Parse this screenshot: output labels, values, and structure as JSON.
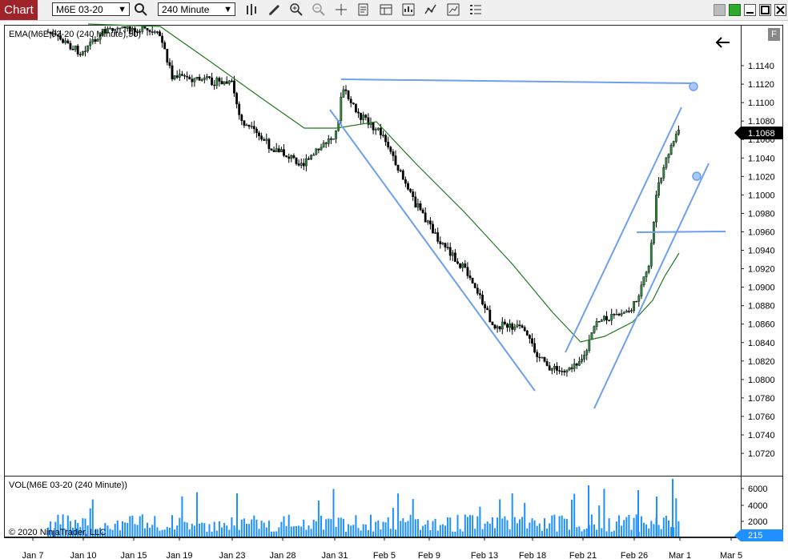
{
  "toolbar": {
    "chart_tab": "Chart",
    "instrument": "M6E 03-20",
    "interval": "240 Minute",
    "icons": [
      "search-icon",
      "bar-type-icon",
      "pencil-draw-icon",
      "zoom-in-icon",
      "zoom-out-icon",
      "crosshair-icon",
      "data-box-icon",
      "properties-icon",
      "strategies-icon",
      "indicators-icon",
      "chart-trader-icon",
      "list-icon"
    ],
    "window_icons": [
      "minimize-gray-icon",
      "green-link-icon",
      "minimize-icon",
      "maximize-icon",
      "close-icon"
    ]
  },
  "price_panel": {
    "indicator_label": "EMA(M6E 03-20 (240 Minute),50)",
    "f_badge": "F",
    "current_price": "1.1068",
    "y_axis": [
      "1.1140",
      "1.1120",
      "1.1100",
      "1.1080",
      "1.1060",
      "1.1040",
      "1.1020",
      "1.1000",
      "1.0980",
      "1.0960",
      "1.0940",
      "1.0920",
      "1.0900",
      "1.0880",
      "1.0860",
      "1.0840",
      "1.0820",
      "1.0800",
      "1.0780",
      "1.0760",
      "1.0740",
      "1.0720"
    ]
  },
  "volume_panel": {
    "label": "VOL(M6E 03-20 (240 Minute))",
    "y_axis": [
      "6000",
      "4000",
      "2000"
    ],
    "current_volume": "215",
    "copyright": "© 2020 NinjaTrader, LLC"
  },
  "x_axis": [
    "Jan 7",
    "Jan 10",
    "Jan 15",
    "Jan 19",
    "Jan 23",
    "Jan 28",
    "Jan 31",
    "Feb 5",
    "Feb 9",
    "Feb 13",
    "Feb 18",
    "Feb 21",
    "Feb 26",
    "Mar 1",
    "Mar 5"
  ],
  "colors": {
    "accent": "#a0232a",
    "up_candle": "#2e8b3e",
    "down_candle": "#000000",
    "ema": "#1f7a1f",
    "drawing": "#6e9ff0",
    "volume": "#1e90ff",
    "current_marker": "#000000"
  }
}
